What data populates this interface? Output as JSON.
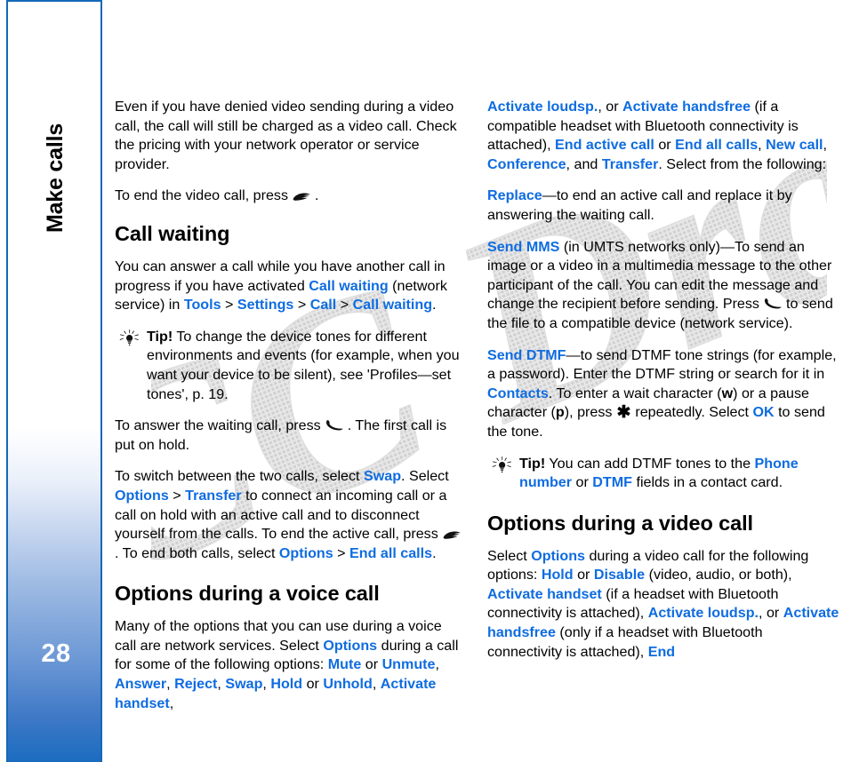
{
  "sidebar": {
    "chapter_title": "Make calls",
    "page_number": "28",
    "border_color": "#1468b8",
    "gradient_bottom_color": "#1b6cc0"
  },
  "watermark": {
    "text": "FCC Draft",
    "color": "#d9d9d9",
    "rotation_deg": -22
  },
  "theme": {
    "link_color": "#0f6ce0",
    "body_color": "#000000",
    "background": "#ffffff"
  },
  "left_column": {
    "p1": {
      "text": "Even if you have denied video sending during a video call, the call will still be charged as a video call. Check the pricing with your network operator or service provider."
    },
    "p2": {
      "before": "To end the video call, press",
      "icon": "end-call-key-icon",
      "after": "."
    },
    "heading1": "Call waiting",
    "p3": {
      "s1": "You can answer a call while you have another call in progress if you have activated ",
      "link1": "Call waiting",
      "s2": " (network service) in ",
      "link2": "Tools",
      "gt1": " > ",
      "link3": "Settings",
      "gt2": " > ",
      "link4": "Call",
      "gt3": " > ",
      "link5": "Call waiting",
      "s3": "."
    },
    "tip1": {
      "icon": "tip-lightbulb-icon",
      "label": "Tip!",
      "text": " To change the device tones for different environments and events (for example, when you want your device to be silent), see 'Profiles—set tones', p. 19."
    },
    "p4": {
      "before": "To answer the waiting call, press",
      "icon": "answer-call-key-icon",
      "after": ". The first call is put on hold."
    },
    "p5": {
      "s1": "To switch between the two calls, select ",
      "link1": "Swap",
      "s2": ". Select ",
      "link2": "Options",
      "gt1": " > ",
      "link3": "Transfer",
      "s3": " to connect an incoming call or a call on hold with an active call and to disconnect yourself from the calls. To end the active call, press",
      "icon": "end-call-key-icon",
      "s4": ". To end both calls, select ",
      "link4": "Options",
      "gt2": " > ",
      "link5": "End all calls",
      "s5": "."
    },
    "heading2": "Options during a voice call",
    "p6": {
      "s1": "Many of the options that you can use during a voice call are network services. Select ",
      "link1": "Options",
      "s2": " during a call for some of the following options: ",
      "link2": "Mute",
      "s3": " or ",
      "link3": "Unmute",
      "s4": ", ",
      "link4": "Answer",
      "s5": ", ",
      "link5": "Reject",
      "s6": ", ",
      "link6": "Swap",
      "s7": ", ",
      "link7": "Hold",
      "s8": " or ",
      "link8": "Unhold",
      "s9": ", ",
      "link9": "Activate handset",
      "s10": ","
    }
  },
  "right_column": {
    "p1": {
      "link1": "Activate loudsp.",
      "s1": ", or ",
      "link2": "Activate handsfree",
      "s2": " (if a compatible headset with Bluetooth connectivity is attached), ",
      "link3": "End active call",
      "s3": " or ",
      "link4": "End all calls",
      "s4": ", ",
      "link5": "New call",
      "s5": ", ",
      "link6": "Conference",
      "s6": ", and ",
      "link7": "Transfer",
      "s7": ". Select from the following:"
    },
    "p2": {
      "link1": "Replace",
      "s1": "—to end an active call and replace it by answering the waiting call."
    },
    "p3": {
      "link1": "Send MMS",
      "s1": " (in UMTS networks only)—To send an image or a video in a multimedia message to the other participant of the call. You can edit the message and change the recipient before sending. Press",
      "icon": "answer-call-key-icon",
      "s2": "to send the file to a compatible device (network service)."
    },
    "p4": {
      "link1": "Send DTMF",
      "s1": "—to send DTMF tone strings (for example, a password). Enter the DTMF string or search for it in ",
      "link2": "Contacts",
      "s2": ". To enter a wait character (",
      "bold1": "w",
      "s3": ") or a pause character (",
      "bold2": "p",
      "s4": "), press",
      "icon": "asterisk-key-icon",
      "s5": "repeatedly. Select ",
      "link3": "OK",
      "s6": " to send the tone."
    },
    "tip1": {
      "icon": "tip-lightbulb-icon",
      "label": "Tip!",
      "s1": " You can add DTMF tones to the ",
      "link1": "Phone number",
      "s2": " or ",
      "link2": "DTMF",
      "s3": " fields in a contact card."
    },
    "heading1": "Options during a video call",
    "p5": {
      "s1": "Select ",
      "link1": "Options",
      "s2": " during a video call for the following options: ",
      "link2": "Hold",
      "s3": " or ",
      "link3": "Disable",
      "s4": " (video, audio, or both), ",
      "link4": "Activate handset",
      "s5": " (if a headset with Bluetooth connectivity is attached), ",
      "link5": "Activate loudsp.",
      "s6": ", or ",
      "link6": "Activate handsfree",
      "s7": " (only if a headset with Bluetooth connectivity is attached), ",
      "link7": "End"
    }
  }
}
